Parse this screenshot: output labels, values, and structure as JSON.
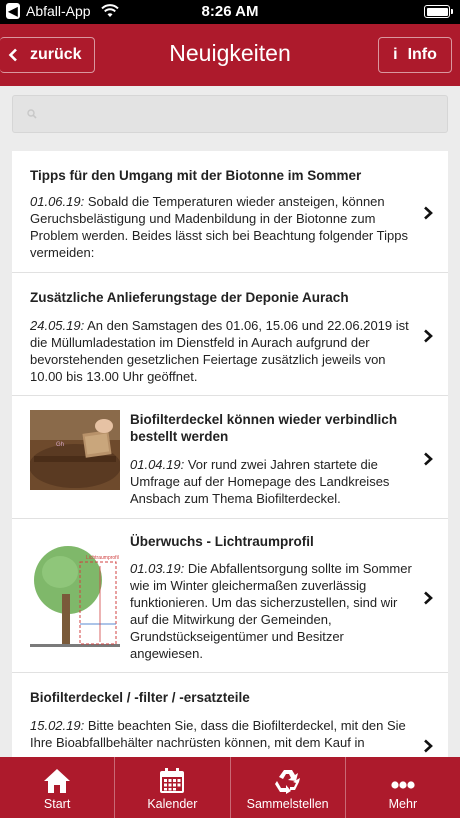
{
  "status_bar": {
    "back_app": "Abfall-App",
    "time": "8:26 AM"
  },
  "header": {
    "back_label": "zurück",
    "title": "Neuigkeiten",
    "info_label": "Info",
    "info_icon_char": "i",
    "back_icon_char": "<"
  },
  "search": {
    "placeholder": ""
  },
  "news": [
    {
      "title": "Tipps für den Umgang mit der Biotonne im Sommer",
      "date": "01.06.19:",
      "text": " Sobald die Temperaturen wieder ansteigen, können Geruchsbelästigung und Madenbildung in der Biotonne zum Problem werden. Beides lässt sich bei Beachtung folgender Tipps vermeiden:"
    },
    {
      "title": "Zusätzliche Anlieferungstage der Deponie Aurach",
      "date": "24.05.19:",
      "text": " An den Samstagen des 01.06, 15.06 und 22.06.2019 ist die Müllumladestation im Dienstfeld in Aurach aufgrund der bevorstehenden gesetzlichen Feiertage zusätzlich jeweils von 10.00 bis 13.00 Uhr geöffnet."
    },
    {
      "title": "Biofilterdeckel können wieder verbindlich bestellt werden",
      "date": "01.04.19:",
      "text": " Vor rund zwei Jahren startete die Umfrage auf der Homepage des Landkreises Ansbach zum Thema Biofilterdeckel."
    },
    {
      "title": "Überwuchs - Lichtraumprofil",
      "date": "01.03.19:",
      "text": " Die Abfallentsorgung sollte im Sommer wie im Winter gleichermaßen zuverlässig funktionieren. Um das sicherzustellen, sind wir auf die Mitwirkung der Gemeinden, Grundstückseigentümer und Besitzer angewiesen."
    },
    {
      "title": "Biofilterdeckel / -filter / -ersatzteile",
      "date": "15.02.19:",
      "text": " Bitte beachten Sie, dass die Biofilterdeckel, mit den Sie Ihre Bioabfallbehälter nachrüsten können, mit dem Kauf in"
    }
  ],
  "tabs": [
    {
      "label": "Start",
      "icon": "home-icon"
    },
    {
      "label": "Kalender",
      "icon": "calendar-icon"
    },
    {
      "label": "Sammelstellen",
      "icon": "recycle-icon"
    },
    {
      "label": "Mehr",
      "icon": "more-icon"
    }
  ],
  "colors": {
    "brand": "#ad1a2c",
    "background": "#ececec"
  }
}
